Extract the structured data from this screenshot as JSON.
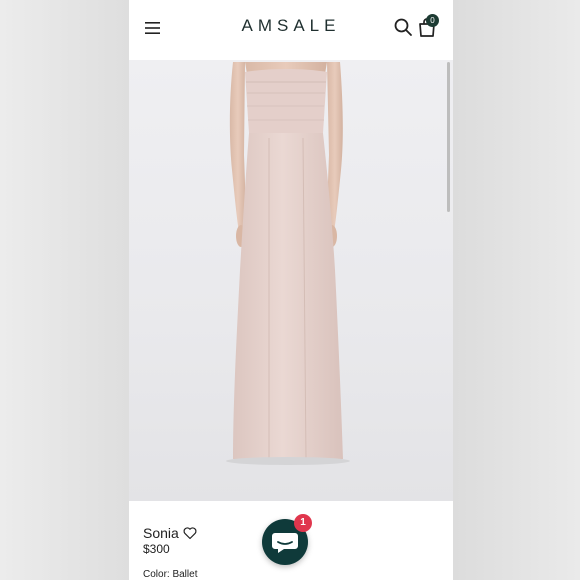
{
  "header": {
    "brand": "AMSALE",
    "menu_icon": "hamburger-menu-icon",
    "search_icon": "search-icon",
    "bag_icon": "shopping-bag-icon",
    "cart_count": "0"
  },
  "product": {
    "image_alt": "Model wearing Sonia strapless blush column gown",
    "name": "Sonia",
    "wishlist_icon": "heart-icon",
    "price": "$300",
    "color_label": "Color: Ballet"
  },
  "chat": {
    "icon": "chat-bubble-icon",
    "badge_count": "1"
  },
  "colors": {
    "brand_dark": "#1d3b33",
    "chat_button": "#0f3a3a",
    "badge_red": "#e0364d",
    "gown_blush": "#e6d2cd"
  }
}
